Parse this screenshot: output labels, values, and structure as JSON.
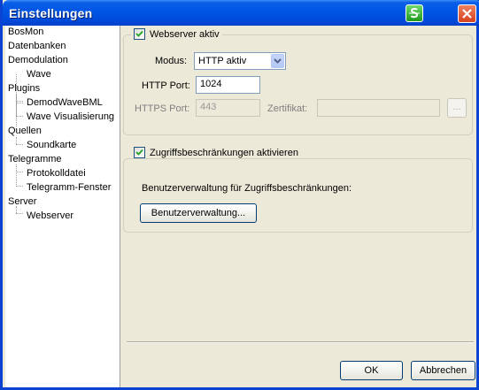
{
  "window": {
    "title": "Einstellungen"
  },
  "tree": {
    "items": [
      {
        "label": "BosMon",
        "level": 0
      },
      {
        "label": "Datenbanken",
        "level": 0
      },
      {
        "label": "Demodulation",
        "level": 0
      },
      {
        "label": "Wave",
        "level": 1
      },
      {
        "label": "Plugins",
        "level": 0
      },
      {
        "label": "DemodWaveBML",
        "level": 1
      },
      {
        "label": "Wave Visualisierung",
        "level": 1
      },
      {
        "label": "Quellen",
        "level": 0
      },
      {
        "label": "Soundkarte",
        "level": 1
      },
      {
        "label": "Telegramme",
        "level": 0
      },
      {
        "label": "Protokolldatei",
        "level": 1
      },
      {
        "label": "Telegramm-Fenster",
        "level": 1
      },
      {
        "label": "Server",
        "level": 0
      },
      {
        "label": "Webserver",
        "level": 1
      }
    ]
  },
  "webserver": {
    "enabled_label": "Webserver aktiv",
    "enabled": true,
    "mode_label": "Modus:",
    "mode_value": "HTTP aktiv",
    "http_port_label": "HTTP Port:",
    "http_port_value": "1024",
    "https_port_label": "HTTPS Port:",
    "https_port_value": "443",
    "certificate_label": "Zertifikat:",
    "certificate_value": "",
    "browse_label": "..."
  },
  "access": {
    "enabled_label": "Zugriffsbeschränkungen aktivieren",
    "enabled": true,
    "description": "Benutzerverwaltung für Zugriffsbeschränkungen:",
    "user_mgmt_button": "Benutzerverwaltung..."
  },
  "footer": {
    "ok_label": "OK",
    "cancel_label": "Abbrechen"
  }
}
